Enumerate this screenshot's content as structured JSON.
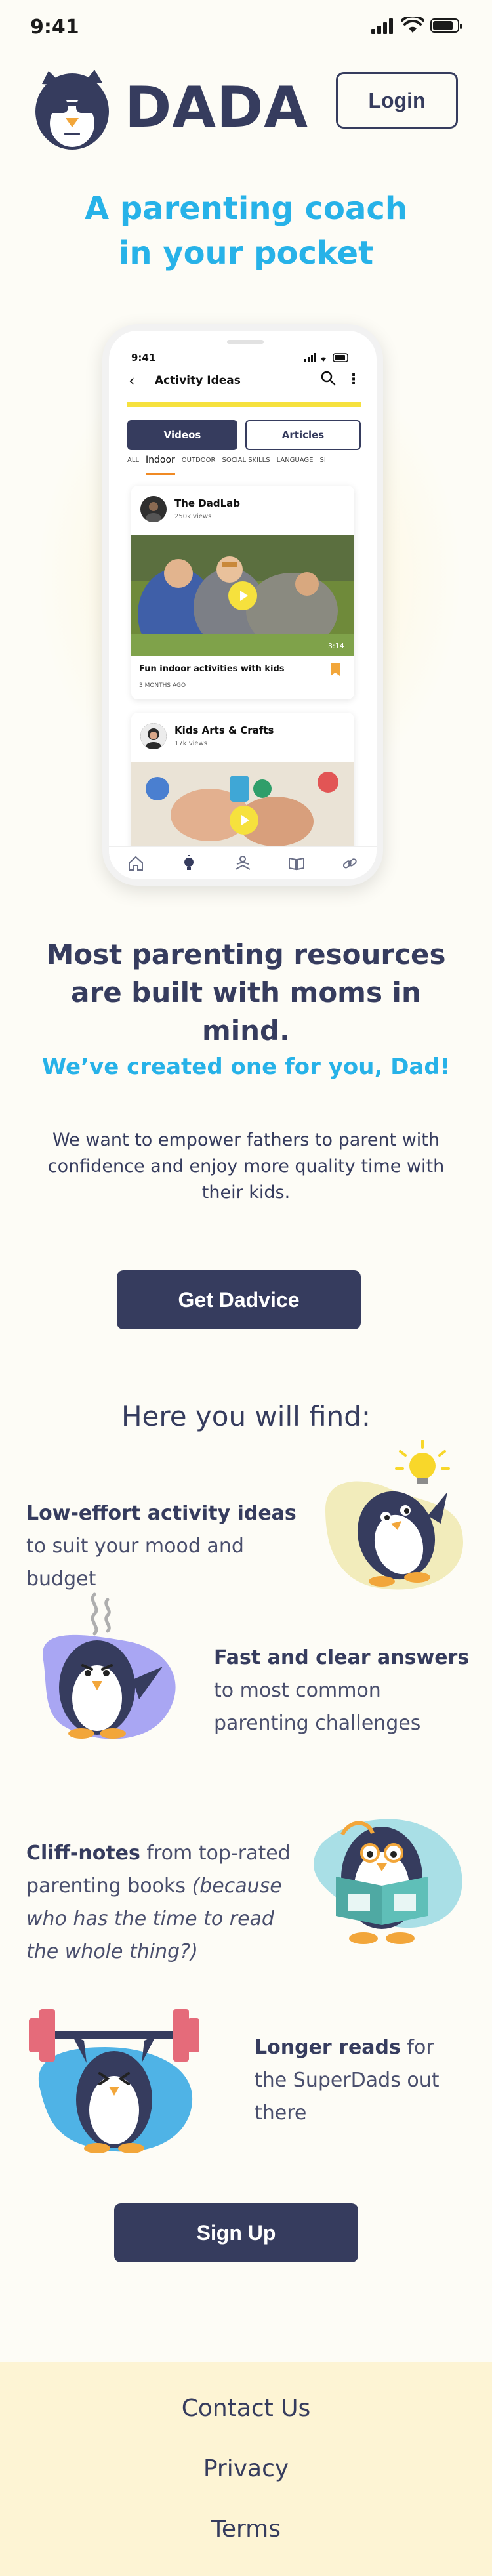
{
  "status_bar": {
    "time": "9:41"
  },
  "header": {
    "brand": "DADA",
    "login_label": "Login"
  },
  "hero": {
    "title": "A parenting coach in your pocket"
  },
  "phone": {
    "time": "9:41",
    "title": "Activity Ideas",
    "tabs": [
      "Videos",
      "Articles"
    ],
    "filters": [
      "ALL",
      "Indoor",
      "OUTDOOR",
      "SOCIAL SKILLS",
      "LANGUAGE",
      "SI"
    ],
    "active_filter": "Indoor",
    "cards": [
      {
        "channel": "The DadLab",
        "views": "250k views",
        "duration": "3:14",
        "title": "Fun indoor activities with kids",
        "date": "3 MONTHS AGO"
      },
      {
        "channel": "Kids Arts & Crafts",
        "views": "17k views"
      }
    ],
    "nav_icons": [
      "home-icon",
      "lightbulb-icon",
      "reading-icon",
      "book-icon",
      "link-icon"
    ]
  },
  "mission": {
    "title": "Most parenting resources are built with moms in mind.",
    "subtitle": "We’ve created one for you, Dad!",
    "description": "We want to empower fathers to parent with confidence and enjoy more quality time with their kids.",
    "cta_label": "Get Dadvice"
  },
  "features": {
    "title": "Here you will find:",
    "items": [
      {
        "bold": "Low-effort activity ideas",
        "rest": " to suit your mood and budget",
        "icon": "penguin-lightbulb-icon",
        "blob": "#f2ecbb"
      },
      {
        "bold": "Fast and clear answers",
        "rest": " to most common parenting challenges",
        "icon": "penguin-thinking-icon",
        "blob": "#a9a6f3"
      },
      {
        "bold": "Cliff-notes",
        "rest": " from top-rated parenting books ",
        "italic": "(because who has the time to read the whole thing?)",
        "icon": "penguin-reading-icon",
        "blob": "#a9dfe6"
      },
      {
        "bold": "Longer reads",
        "rest": " for the SuperDads out there",
        "icon": "penguin-weightlifting-icon",
        "blob": "#4fb3e6"
      }
    ]
  },
  "signup_label": "Sign Up",
  "footer": {
    "links": [
      "Contact Us",
      "Privacy",
      "Terms"
    ]
  },
  "colors": {
    "navy": "#363c5e",
    "sky": "#27b2e8",
    "yellow": "#f6e13d",
    "cream": "#fdf4d4"
  }
}
